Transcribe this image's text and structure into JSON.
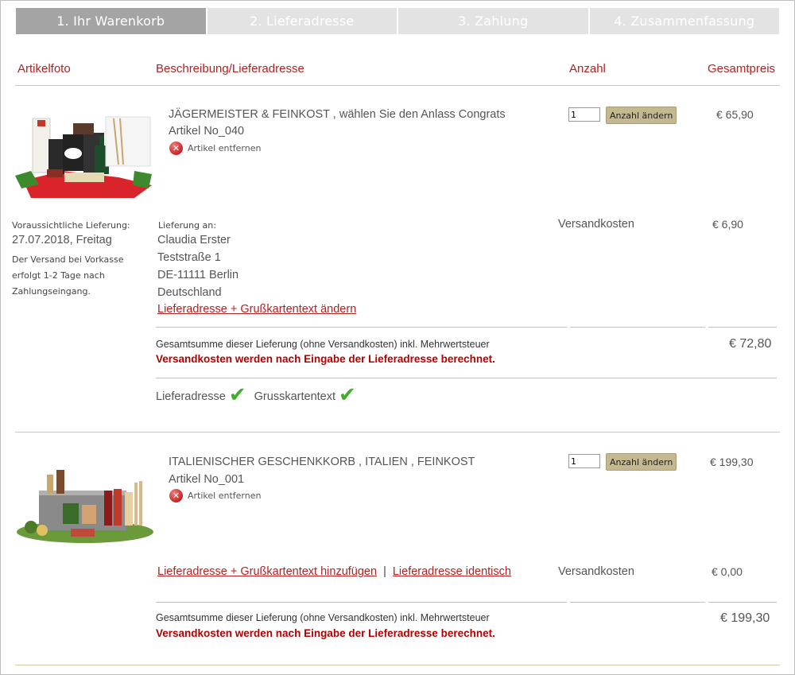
{
  "steps": [
    {
      "label": "1. Ihr Warenkorb",
      "active": true
    },
    {
      "label": "2. Lieferadresse",
      "active": false
    },
    {
      "label": "3. Zahlung",
      "active": false
    },
    {
      "label": "4. Zusammenfassung",
      "active": false
    }
  ],
  "headers": {
    "photo": "Artikelfoto",
    "description": "Beschreibung/Lieferadresse",
    "quantity": "Anzahl",
    "total": "Gesamtpreis"
  },
  "items": [
    {
      "title": "JÄGERMEISTER & FEINKOST , wählen Sie den Anlass Congrats",
      "article_no": "Artikel No_040",
      "remove_label": "Artikel entfernen",
      "quantity": "1",
      "quantity_button": "Anzahl ändern",
      "price": "€ 65,90",
      "delivery_estimate_label": "Voraussichtliche Lieferung:",
      "delivery_date": "27.07.2018, Freitag",
      "delivery_note": "Der Versand bei Vorkasse erfolgt 1-2 Tage nach Zahlungseingang.",
      "deliver_to_label": "Lieferung an:",
      "address": [
        "Claudia Erster",
        "Teststraße 1",
        "DE-11111 Berlin",
        "Deutschland"
      ],
      "address_link": "Lieferadresse + Grußkartentext ändern",
      "shipping_label": "Versandkosten",
      "shipping_price": "€ 6,90",
      "subtotal_text": "Gesamtsumme dieser Lieferung (ohne Versandkosten) inkl. Mehrwertsteuer",
      "shipping_warning": "Versandkosten werden nach Eingabe der Lieferadresse berechnet.",
      "subtotal": "€ 72,80",
      "status_address": "Lieferadresse",
      "status_card": "Grusskartentext"
    },
    {
      "title": "ITALIENISCHER GESCHENKKORB , ITALIEN , FEINKOST",
      "article_no": "Artikel No_001",
      "remove_label": "Artikel entfernen",
      "quantity": "1",
      "quantity_button": "Anzahl ändern",
      "price": "€ 199,30",
      "address_link_add": "Lieferadresse + Grußkartentext hinzufügen",
      "separator": "|",
      "address_link_same": "Lieferadresse identisch",
      "shipping_label": "Versandkosten",
      "shipping_price": "€ 0,00",
      "subtotal_text": "Gesamtsumme dieser Lieferung (ohne Versandkosten) inkl. Mehrwertsteuer",
      "shipping_warning": "Versandkosten werden nach Eingabe der Lieferadresse berechnet.",
      "subtotal": "€ 199,30"
    }
  ],
  "icons": {
    "remove": "remove-circle-icon",
    "check": "checkmark-icon"
  },
  "colors": {
    "accent_red": "#b22222",
    "warning_red": "#b30000",
    "button_tan": "#c4b891",
    "divider": "#d2c7a2",
    "step_active": "#a4a4a4",
    "step_inactive": "#e3e3e3",
    "check_green": "#3fae2a"
  }
}
